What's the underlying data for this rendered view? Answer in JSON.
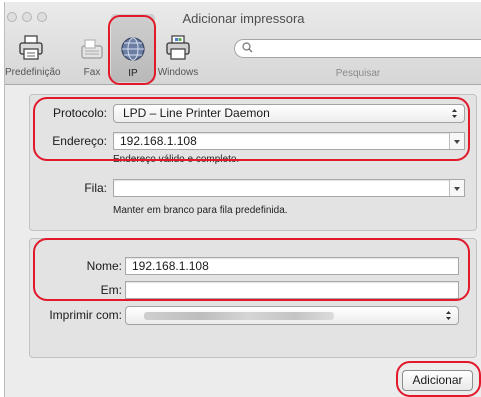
{
  "window": {
    "title": "Adicionar impressora"
  },
  "toolbar": {
    "items": [
      {
        "label": "Predefinição",
        "icon": "printer-icon"
      },
      {
        "label": "Fax",
        "icon": "fax-icon"
      },
      {
        "label": "IP",
        "icon": "globe-icon",
        "selected": true
      },
      {
        "label": "Windows",
        "icon": "windows-printer-icon"
      }
    ],
    "search": {
      "placeholder": "",
      "label": "Pesquisar"
    }
  },
  "connection": {
    "protocol_label": "Protocolo:",
    "protocol_value": "LPD – Line Printer Daemon",
    "address_label": "Endereço:",
    "address_value": "192.168.1.108",
    "address_hint": "Endereço válido e completo.",
    "queue_label": "Fila:",
    "queue_value": "",
    "queue_hint": "Manter em branco para fila predefinida."
  },
  "details": {
    "name_label": "Nome:",
    "name_value": "192.168.1.108",
    "location_label": "Em:",
    "location_value": "",
    "print_using_label": "Imprimir com:"
  },
  "actions": {
    "add_label": "Adicionar"
  },
  "colors": {
    "highlight": "#e1192b",
    "window_bg": "#ececec"
  }
}
